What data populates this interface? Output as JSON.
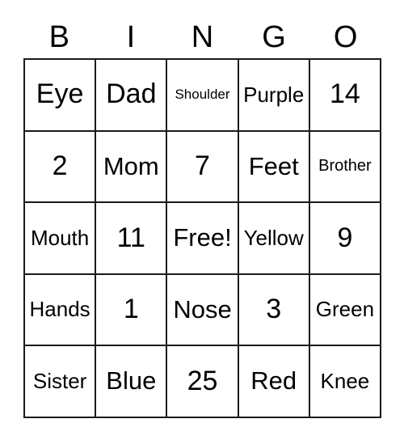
{
  "card": {
    "headers": [
      "B",
      "I",
      "N",
      "G",
      "O"
    ],
    "free_space_label": "Free!",
    "rows": [
      [
        {
          "text": "Eye",
          "size": "fs-xl"
        },
        {
          "text": "Dad",
          "size": "fs-xl"
        },
        {
          "text": "Shoulder",
          "size": "fs-xs"
        },
        {
          "text": "Purple",
          "size": "fs-md"
        },
        {
          "text": "14",
          "size": "fs-xl"
        }
      ],
      [
        {
          "text": "2",
          "size": "fs-xl"
        },
        {
          "text": "Mom",
          "size": "fs-lg"
        },
        {
          "text": "7",
          "size": "fs-xl"
        },
        {
          "text": "Feet",
          "size": "fs-lg"
        },
        {
          "text": "Brother",
          "size": "fs-sm"
        }
      ],
      [
        {
          "text": "Mouth",
          "size": "fs-md"
        },
        {
          "text": "11",
          "size": "fs-xl"
        },
        {
          "text": "Free!",
          "size": "fs-lg"
        },
        {
          "text": "Yellow",
          "size": "fs-md"
        },
        {
          "text": "9",
          "size": "fs-xl"
        }
      ],
      [
        {
          "text": "Hands",
          "size": "fs-md"
        },
        {
          "text": "1",
          "size": "fs-xl"
        },
        {
          "text": "Nose",
          "size": "fs-lg"
        },
        {
          "text": "3",
          "size": "fs-xl"
        },
        {
          "text": "Green",
          "size": "fs-md"
        }
      ],
      [
        {
          "text": "Sister",
          "size": "fs-md"
        },
        {
          "text": "Blue",
          "size": "fs-lg"
        },
        {
          "text": "25",
          "size": "fs-xl"
        },
        {
          "text": "Red",
          "size": "fs-lg"
        },
        {
          "text": "Knee",
          "size": "fs-md"
        }
      ]
    ]
  },
  "colors": {
    "border": "#1a1a1a",
    "cell_background": "#ffffff",
    "text": "#000000",
    "page_background": "#ffffff"
  }
}
